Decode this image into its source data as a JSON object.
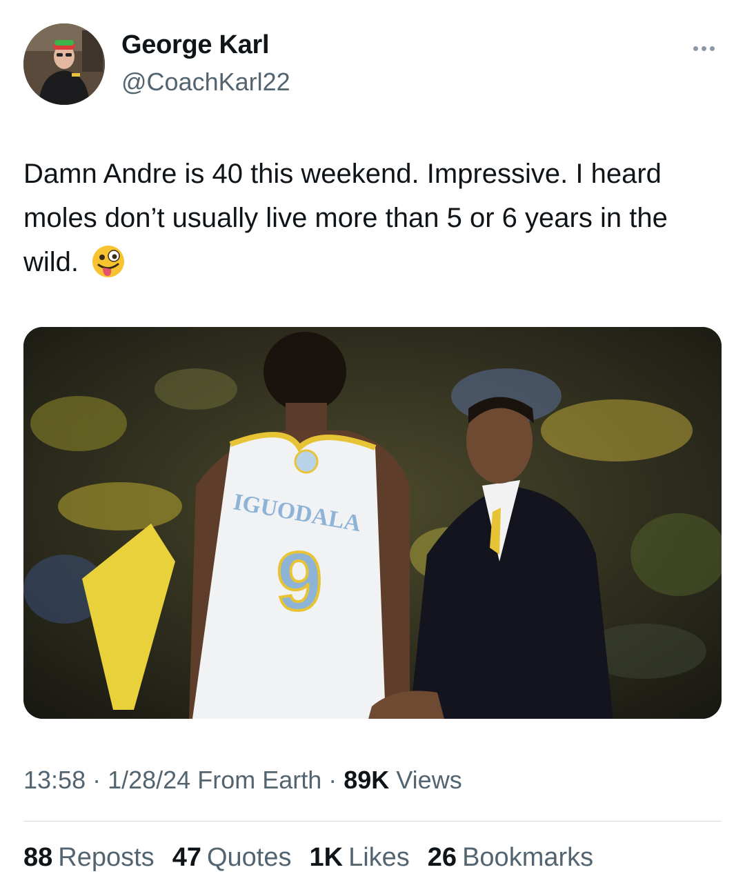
{
  "author": {
    "display_name": "George Karl",
    "handle": "@CoachKarl22",
    "avatar_icon": "profile-photo"
  },
  "more_icon": "ellipsis-icon",
  "tweet": {
    "text": "Damn Andre is 40 this weekend. Impressive. I heard moles don’t usually live more than 5 or 6 years in the wild.",
    "emoji": "zany-face-emoji",
    "media": {
      "jersey_name": "IGUODALA",
      "jersey_number": "9"
    }
  },
  "meta": {
    "time": "13:58",
    "sep1": " · ",
    "date": "1/28/24",
    "source": " From Earth",
    "sep2": " · ",
    "views_count": "89K",
    "views_label": " Views"
  },
  "stats": [
    {
      "count": "88",
      "label": "Reposts"
    },
    {
      "count": "47",
      "label": "Quotes"
    },
    {
      "count": "1K",
      "label": "Likes"
    },
    {
      "count": "26",
      "label": "Bookmarks"
    }
  ],
  "colors": {
    "text_primary": "#0f1419",
    "text_secondary": "#536471",
    "divider": "#cfd9de"
  }
}
